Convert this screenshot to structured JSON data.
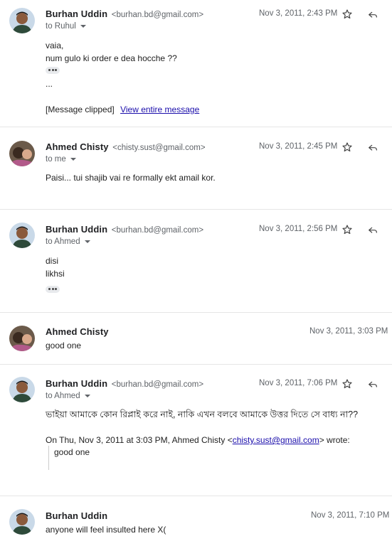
{
  "messages": [
    {
      "sender": "Burhan Uddin",
      "email": "<burhan.bd@gmail.com>",
      "to": "to Ruhul",
      "date": "Nov 3, 2011, 2:43 PM",
      "lines": [
        "vaia,",
        "num gulo ki order e dea hocche ??"
      ],
      "ellipsis": "...",
      "clipped_label": "[Message clipped]",
      "clipped_link": "View entire message"
    },
    {
      "sender": "Ahmed Chisty",
      "email": "<chisty.sust@gmail.com>",
      "to": "to me",
      "date": "Nov 3, 2011, 2:45 PM",
      "lines": [
        "Paisi... tui shajib vai re formally ekt amail kor."
      ]
    },
    {
      "sender": "Burhan Uddin",
      "email": "<burhan.bd@gmail.com>",
      "to": "to Ahmed",
      "date": "Nov 3, 2011, 2:56 PM",
      "lines": [
        "disi",
        "likhsi"
      ]
    },
    {
      "sender": "Ahmed Chisty",
      "date": "Nov 3, 2011, 3:03 PM",
      "snippet": "good one"
    },
    {
      "sender": "Burhan Uddin",
      "email": "<burhan.bd@gmail.com>",
      "to": "to Ahmed",
      "date": "Nov 3, 2011, 7:06 PM",
      "lines": [
        "ভাইয়া আমাকে কোন রিপ্লাই করে নাই, নাকি এখন বলবে আমাকে উত্তর দিতে সে বাধ্য না??"
      ],
      "quote_header_pre": "On Thu, Nov 3, 2011 at 3:03 PM, Ahmed Chisty <",
      "quote_header_link": "chisty.sust@gmail.com",
      "quote_header_post": "> wrote:",
      "quote_text": "good one"
    },
    {
      "sender": "Burhan Uddin",
      "date": "Nov 3, 2011, 7:10 PM",
      "snippet": "anyone will feel insulted here X("
    }
  ],
  "icons": {
    "star": "star-icon",
    "reply": "reply-icon",
    "more": "more-horizontal-icon"
  }
}
